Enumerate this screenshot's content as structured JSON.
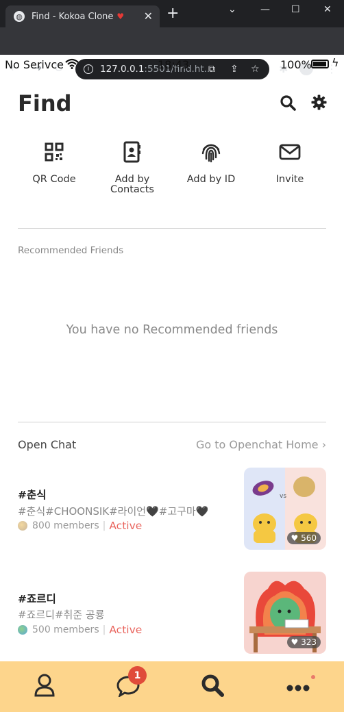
{
  "browser": {
    "tab_title": "Find - Kokoa Clone",
    "tab_emoji": "❤️",
    "url_host": "127.0.0.1",
    "url_rest": ":5501/find.ht..."
  },
  "statusbar": {
    "carrier": "No Serivce",
    "time": "18:43",
    "battery": "100%"
  },
  "header": {
    "title": "Find"
  },
  "actions": [
    {
      "label": "QR Code",
      "icon": "qr-code-icon"
    },
    {
      "label": "Add by Contacts",
      "icon": "address-book-icon"
    },
    {
      "label": "Add by ID",
      "icon": "fingerprint-icon"
    },
    {
      "label": "Invite",
      "icon": "envelope-icon"
    }
  ],
  "recommended": {
    "label": "Recommended Friends",
    "empty_text": "You have no Recommended friends"
  },
  "openchat": {
    "title": "Open Chat",
    "link": "Go to Openchat Home",
    "items": [
      {
        "name": "#춘식",
        "tags": "#춘식#CHOONSIK#라이언🖤#고구마🖤",
        "members": "800 members",
        "status": "Active",
        "likes": "560"
      },
      {
        "name": "#죠르디",
        "tags": "#죠르디#취준 공룡",
        "members": "500 members",
        "status": "Active",
        "likes": "323"
      }
    ]
  },
  "tabbar": {
    "chat_badge": "1"
  },
  "colors": {
    "tabbar_bg": "#fdd58c",
    "active": "#e9645d",
    "badge": "#e04b3a"
  }
}
